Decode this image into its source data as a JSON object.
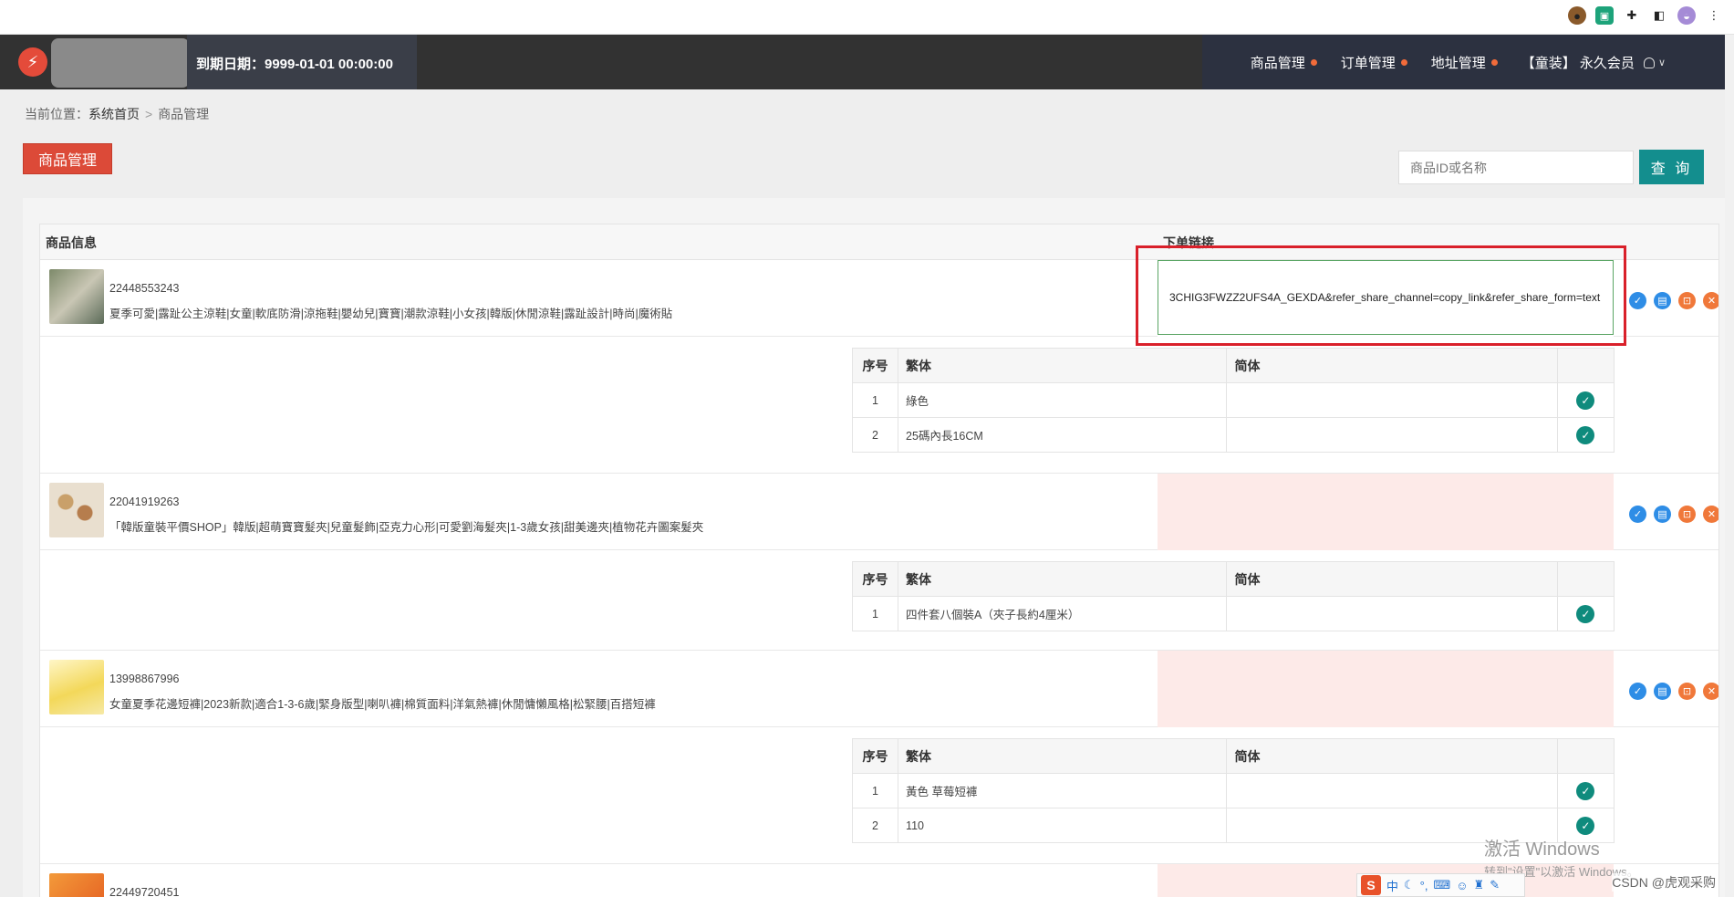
{
  "browser": {
    "extensions": [
      "cookie-icon",
      "green-extension-icon",
      "puzzle-icon",
      "sidebar-icon",
      "avatar-icon",
      "more-icon"
    ]
  },
  "header": {
    "expire_label": "到期日期：9999-01-01 00:00:00",
    "nav": [
      {
        "label": "商品管理"
      },
      {
        "label": "订单管理"
      },
      {
        "label": "地址管理"
      }
    ],
    "member": "【童装】 永久会员"
  },
  "breadcrumb": {
    "prefix": "当前位置：",
    "home": "系统首页",
    "separator": ">",
    "current": "商品管理"
  },
  "page": {
    "title": "商品管理"
  },
  "search": {
    "placeholder": "商品ID或名称",
    "button": "查 询"
  },
  "table": {
    "col_info": "商品信息",
    "col_link": "下单链接",
    "link_value": "3CHIG3FWZZ2UFS4A_GEXDA&refer_share_channel=copy_link&refer_share_form=text",
    "sub_headers": {
      "index": "序号",
      "traditional": "繁体",
      "simplified": "简体"
    },
    "products": [
      {
        "id": "22448553243",
        "name": "夏季可愛|露趾公主涼鞋|女童|軟底防滑|涼拖鞋|嬰幼兒|寶寶|潮款涼鞋|小女孩|韓版|休閒涼鞋|露趾設計|時尚|魔術貼",
        "variants": [
          {
            "index": "1",
            "traditional": "綠色",
            "simplified": ""
          },
          {
            "index": "2",
            "traditional": "25碼內長16CM",
            "simplified": ""
          }
        ]
      },
      {
        "id": "22041919263",
        "name": "「韓版童裝平價SHOP」韓版|超萌寶寶髮夾|兒童髮飾|亞克力心形|可愛劉海髮夾|1-3歲女孩|甜美邊夾|植物花卉圖案髮夾",
        "variants": [
          {
            "index": "1",
            "traditional": "四件套八個裝A（夾子長約4厘米）",
            "simplified": ""
          }
        ]
      },
      {
        "id": "13998867996",
        "name": "女童夏季花邊短褲|2023新款|適合1-3-6歲|緊身版型|喇叭褲|棉質面料|洋氣熱褲|休閒慵懶風格|松緊腰|百搭短褲",
        "variants": [
          {
            "index": "1",
            "traditional": "黃色 草莓短褲",
            "simplified": ""
          },
          {
            "index": "2",
            "traditional": "110",
            "simplified": ""
          }
        ]
      },
      {
        "id": "22449720451",
        "name": "",
        "variants": []
      }
    ]
  },
  "watermark": {
    "line1": "激活 Windows",
    "line2": "转到\"设置\"以激活 Windows。"
  },
  "ime": {
    "label": "中"
  },
  "credit": "CSDN @虎观采购",
  "colors": {
    "primary_red": "#dc4a38",
    "teal": "#138e8e",
    "link_bg": "#fdeae8",
    "highlight": "#d9202a"
  }
}
